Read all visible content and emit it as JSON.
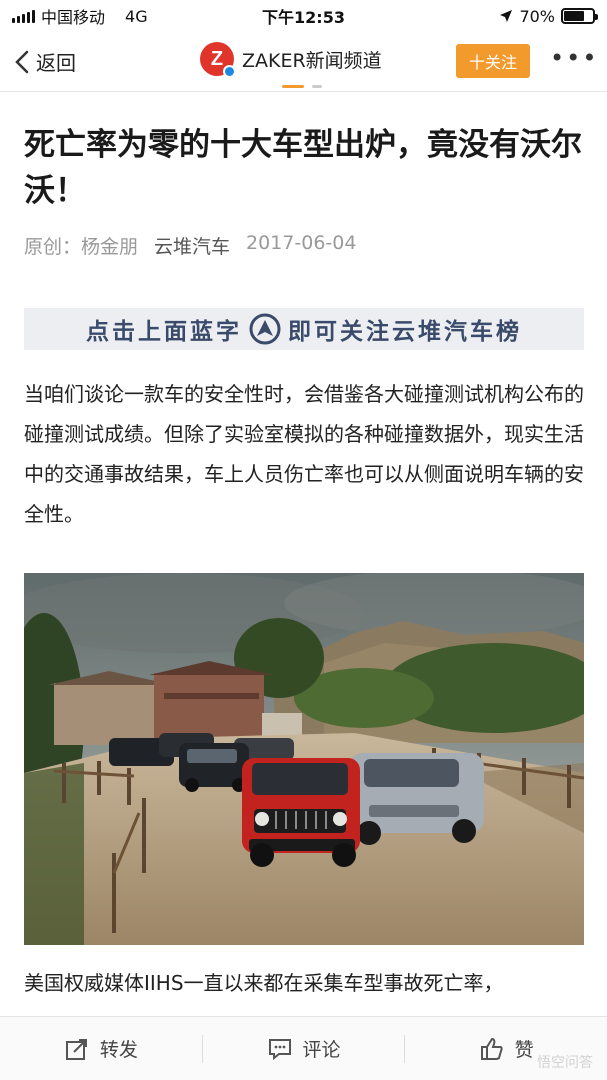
{
  "status_bar": {
    "carrier": "中国移动",
    "network": "4G",
    "time": "下午12:53",
    "battery_text": "70%",
    "battery_level": 0.7,
    "icons": [
      "signal-icon",
      "location-arrow-icon",
      "battery-icon"
    ]
  },
  "nav": {
    "back_label": "返回",
    "channel_logo_text": "Z",
    "channel_name": "ZAKER新闻频道",
    "follow_label": "十关注",
    "more_label": "•••",
    "accent_color": "#f39a2c"
  },
  "article": {
    "title": "死亡率为零的十大车型出炉，竟没有沃尔沃！",
    "meta": {
      "author": "原创：杨金朋",
      "source": "云堆汽车",
      "date": "2017-06-04"
    },
    "banner_left": "点击上面蓝字",
    "banner_right": "即可关注云堆汽车榜",
    "paragraph_1": "当咱们谈论一款车的安全性时，会借鉴各大碰撞测试机构公布的碰撞测试成绩。但除了实验室模拟的各种碰撞数据外，现实生活中的交通事故结果，车上人员伤亡率也可以从侧面说明车辆的安全性。",
    "paragraph_2": "美国权威媒体IIHS一直以来都在采集车型事故死亡率，"
  },
  "bottom_bar": {
    "share_label": "转发",
    "comment_label": "评论",
    "like_label": "赞",
    "watermark": "悟空问答"
  }
}
